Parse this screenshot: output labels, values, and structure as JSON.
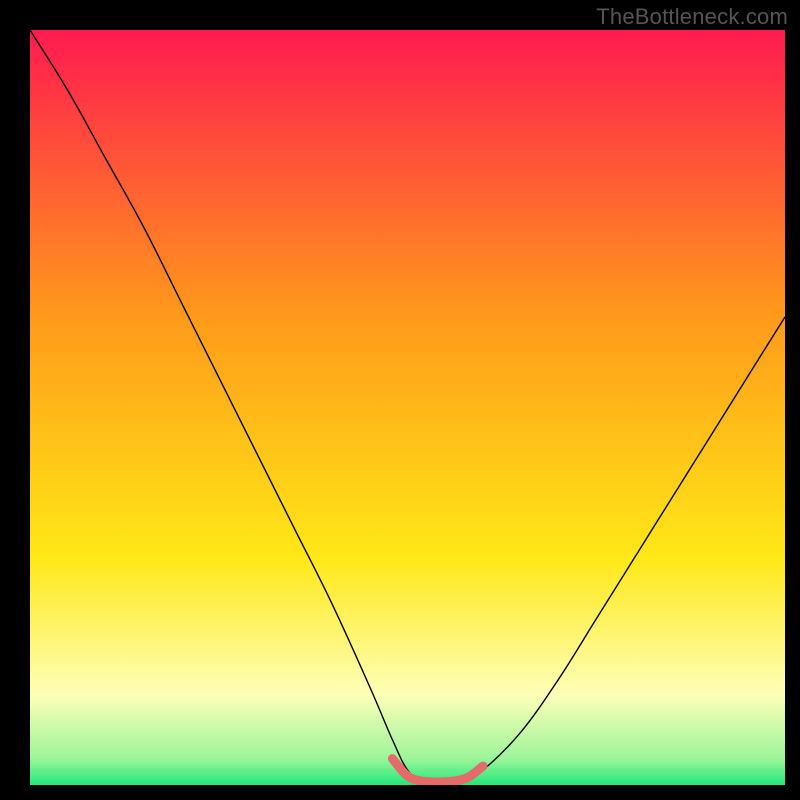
{
  "watermark": "TheBottleneck.com",
  "colors": {
    "frame": "#000000",
    "top": "#ff1a50",
    "upper_mid": "#ff9a1a",
    "lower_mid": "#ffe818",
    "pale": "#feffb8",
    "bottom": "#23e77a",
    "curve": "#000000",
    "highlight": "#e56a6a"
  },
  "chart_data": {
    "type": "line",
    "title": "",
    "xlabel": "",
    "ylabel": "",
    "xlim": [
      0,
      100
    ],
    "ylim": [
      0,
      100
    ],
    "x": [
      0,
      5,
      10,
      15,
      20,
      25,
      30,
      35,
      40,
      45,
      48,
      50,
      52,
      55,
      57,
      60,
      65,
      70,
      75,
      80,
      85,
      90,
      95,
      100
    ],
    "values": [
      100,
      92,
      83,
      74,
      64,
      54,
      44,
      34,
      24,
      13,
      6,
      2,
      0.5,
      0.4,
      0.5,
      2,
      7,
      14,
      22,
      30,
      38,
      46,
      54,
      62
    ],
    "highlight_segment": {
      "x": [
        48,
        50,
        52,
        54,
        56,
        58,
        60
      ],
      "values": [
        3.5,
        1.2,
        0.5,
        0.4,
        0.5,
        1.0,
        2.5
      ]
    },
    "gradient_stops": [
      {
        "offset": 0.0,
        "color": "#ff1a50"
      },
      {
        "offset": 0.38,
        "color": "#ff9a1a"
      },
      {
        "offset": 0.7,
        "color": "#ffe818"
      },
      {
        "offset": 0.88,
        "color": "#feffb8"
      },
      {
        "offset": 0.965,
        "color": "#9cf59a"
      },
      {
        "offset": 1.0,
        "color": "#23e77a"
      }
    ]
  }
}
